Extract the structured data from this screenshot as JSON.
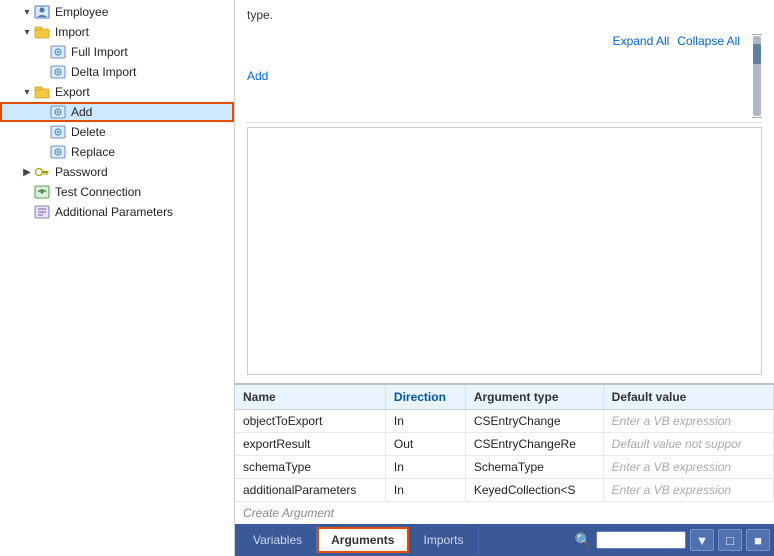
{
  "sidebar": {
    "items": [
      {
        "id": "employee",
        "label": "Employee",
        "indent": 0,
        "expanded": true,
        "icon": "person",
        "hasChevron": true,
        "chevron": "▾"
      },
      {
        "id": "import",
        "label": "Import",
        "indent": 1,
        "expanded": true,
        "icon": "folder",
        "hasChevron": true,
        "chevron": "▾"
      },
      {
        "id": "full-import",
        "label": "Full Import",
        "indent": 2,
        "icon": "gear-import",
        "hasChevron": false
      },
      {
        "id": "delta-import",
        "label": "Delta Import",
        "indent": 2,
        "icon": "gear-import",
        "hasChevron": false
      },
      {
        "id": "export",
        "label": "Export",
        "indent": 1,
        "expanded": true,
        "icon": "folder",
        "hasChevron": true,
        "chevron": "▾"
      },
      {
        "id": "add",
        "label": "Add",
        "indent": 2,
        "icon": "gear-add",
        "hasChevron": false,
        "selected": true,
        "highlighted": true
      },
      {
        "id": "delete",
        "label": "Delete",
        "indent": 2,
        "icon": "gear-delete",
        "hasChevron": false
      },
      {
        "id": "replace",
        "label": "Replace",
        "indent": 2,
        "icon": "gear-replace",
        "hasChevron": false
      },
      {
        "id": "password",
        "label": "Password",
        "indent": 1,
        "icon": "key",
        "hasChevron": true,
        "chevron": "▶",
        "collapsed": true
      },
      {
        "id": "test-connection",
        "label": "Test Connection",
        "indent": 0,
        "icon": "connection",
        "hasChevron": false
      },
      {
        "id": "additional-params",
        "label": "Additional Parameters",
        "indent": 0,
        "icon": "params",
        "hasChevron": false
      }
    ]
  },
  "main": {
    "top_text": "type.",
    "toolbar": {
      "add_label": "Add",
      "expand_all_label": "Expand All",
      "collapse_all_label": "Collapse All"
    },
    "table": {
      "columns": [
        "Name",
        "Direction",
        "Argument type",
        "Default value"
      ],
      "rows": [
        {
          "name": "objectToExport",
          "direction": "In",
          "argtype": "CSEntryChange",
          "default": "Enter a VB expression"
        },
        {
          "name": "exportResult",
          "direction": "Out",
          "argtype": "CSEntryChangeRe",
          "default": "Default value not suppor"
        },
        {
          "name": "schemaType",
          "direction": "In",
          "argtype": "SchemaType",
          "default": "Enter a VB expression"
        },
        {
          "name": "additionalParameters",
          "direction": "In",
          "argtype": "KeyedCollection<S",
          "default": "Enter a VB expression"
        }
      ],
      "create_arg_label": "Create Argument"
    }
  },
  "tabs": {
    "items": [
      {
        "id": "variables",
        "label": "Variables",
        "active": false
      },
      {
        "id": "arguments",
        "label": "Arguments",
        "active": true
      },
      {
        "id": "imports",
        "label": "Imports",
        "active": false
      }
    ],
    "search_placeholder": ""
  },
  "colors": {
    "accent": "#e05000",
    "tab_bar_bg": "#3b5998",
    "tab_active_outline": "#e05000",
    "header_blue": "#0055aa"
  }
}
